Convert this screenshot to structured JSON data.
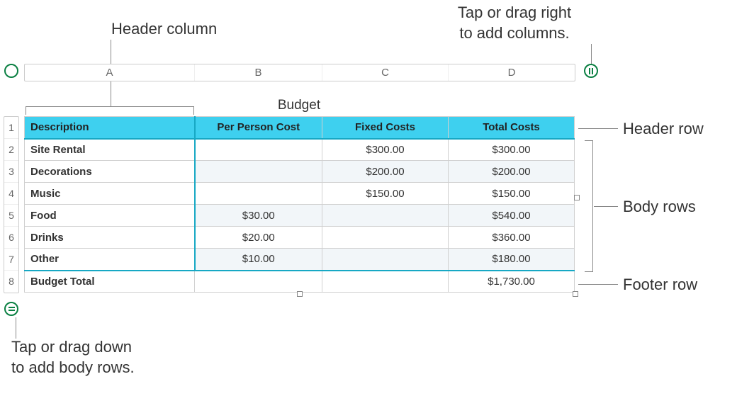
{
  "callouts": {
    "header_column": "Header column",
    "add_columns": "Tap or drag right\nto add columns.",
    "header_row": "Header row",
    "body_rows": "Body rows",
    "footer_row": "Footer row",
    "add_rows": "Tap or drag down\nto add body rows."
  },
  "table_title": "Budget",
  "column_letters": [
    "A",
    "B",
    "C",
    "D"
  ],
  "row_numbers": [
    "1",
    "2",
    "3",
    "4",
    "5",
    "6",
    "7",
    "8"
  ],
  "columns": {
    "a": "Description",
    "b": "Per Person Cost",
    "c": "Fixed Costs",
    "d": "Total Costs"
  },
  "rows": [
    {
      "a": "Site Rental",
      "b": "",
      "c": "$300.00",
      "d": "$300.00"
    },
    {
      "a": "Decorations",
      "b": "",
      "c": "$200.00",
      "d": "$200.00"
    },
    {
      "a": "Music",
      "b": "",
      "c": "$150.00",
      "d": "$150.00"
    },
    {
      "a": "Food",
      "b": "$30.00",
      "c": "",
      "d": "$540.00"
    },
    {
      "a": "Drinks",
      "b": "$20.00",
      "c": "",
      "d": "$360.00"
    },
    {
      "a": "Other",
      "b": "$10.00",
      "c": "",
      "d": "$180.00"
    }
  ],
  "footer": {
    "a": "Budget Total",
    "b": "",
    "c": "",
    "d": "$1,730.00"
  }
}
